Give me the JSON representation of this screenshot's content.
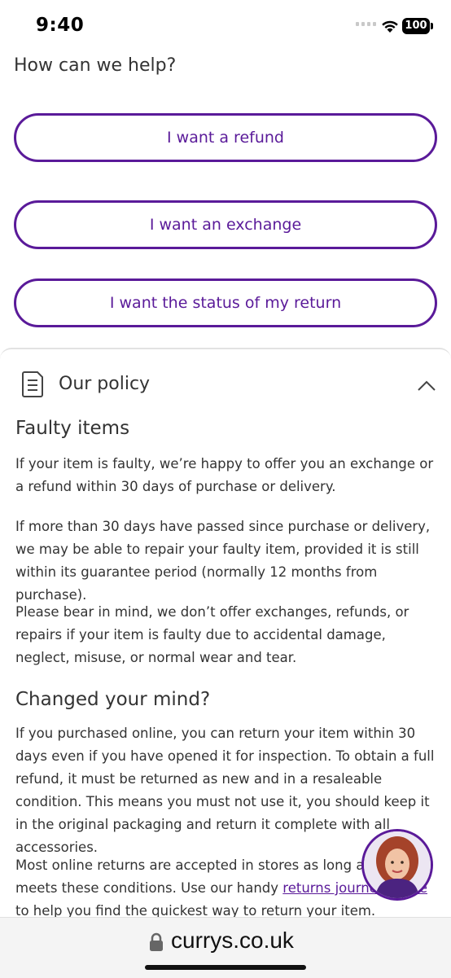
{
  "status_bar": {
    "time": "9:40",
    "battery": "100"
  },
  "help": {
    "title": "How can we help?",
    "buttons": {
      "refund": "I want a refund",
      "exchange": "I want an exchange",
      "status": "I want the status of my return"
    }
  },
  "policy": {
    "title": "Our policy",
    "faulty": {
      "heading": "Faulty items",
      "p1": "If your item is faulty, we’re happy to offer you an exchange or a refund within 30 days of purchase or delivery.",
      "p2": "If more than 30 days have passed since purchase or delivery, we may be able to repair your faulty item, provided it is still within its guarantee period (normally 12 months from purchase).",
      "p3": "Please bear in mind, we don’t offer exchanges, refunds, or repairs if your item is faulty due to accidental damage, neglect, misuse, or normal wear and tear."
    },
    "changed": {
      "heading": "Changed your mind?",
      "p1": "If you purchased online, you can return your item within 30 days even if you have opened it for inspection. To obtain a full refund, it must be returned as new and in a resaleable condition. This means you must not use it, you should keep it in the original packaging and return it complete with all accessories.",
      "p2_before": "Most online returns are accepted in stores as long as the item meets these conditions. Use our handy ",
      "p2_link": "returns journey guide",
      "p2_after": " to help you find the quickest way to return your item."
    }
  },
  "browser": {
    "url": "currys.co.uk"
  },
  "colors": {
    "brand_purple": "#5a1a99"
  }
}
